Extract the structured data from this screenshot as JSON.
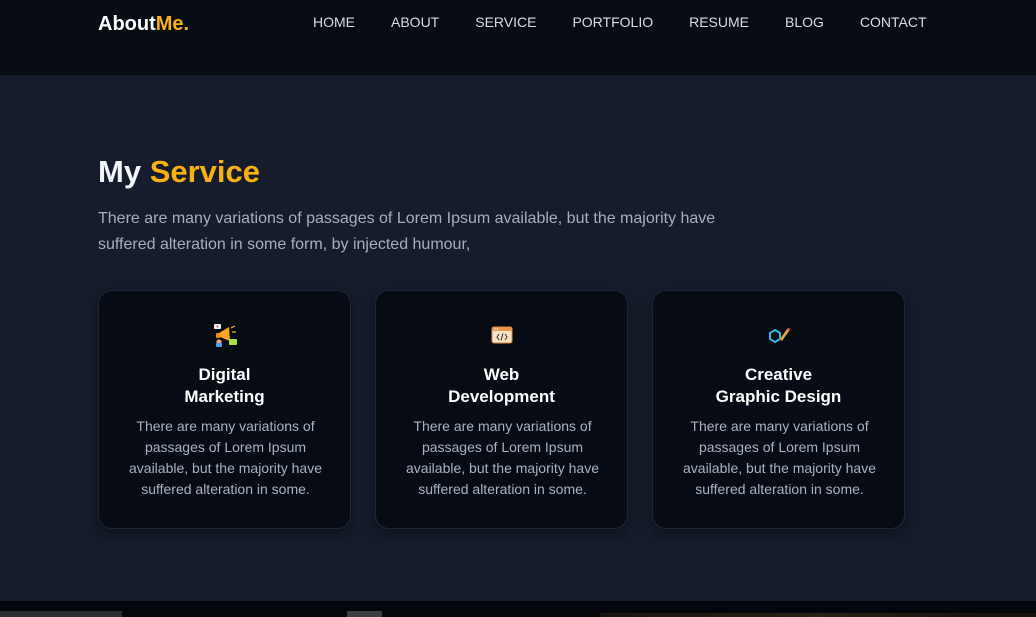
{
  "brand": {
    "name_main": "About",
    "name_accent": "Me."
  },
  "nav": {
    "items": [
      {
        "label": "HOME"
      },
      {
        "label": "ABOUT"
      },
      {
        "label": "SERVICE"
      },
      {
        "label": "PORTFOLIO"
      },
      {
        "label": "RESUME"
      },
      {
        "label": "BLOG"
      },
      {
        "label": "CONTACT"
      }
    ]
  },
  "services": {
    "title_main": "My",
    "title_accent": "Service",
    "description_line1": "There are many variations of passages of Lorem Ipsum available, but the majority have",
    "description_line2": "suffered alteration in some form, by injected humour,",
    "cards": [
      {
        "icon": "megaphone-icon",
        "title_line1": "Digital",
        "title_line2": "Marketing",
        "text": "There are many variations of passages of Lorem Ipsum available, but the majority have suffered alteration in some."
      },
      {
        "icon": "code-window-icon",
        "title_line1": "Web",
        "title_line2": "Development",
        "text": "There are many variations of passages of Lorem Ipsum available, but the majority have suffered alteration in some."
      },
      {
        "icon": "design-pencil-icon",
        "title_line1": "Creative",
        "title_line2": "Graphic Design",
        "text": "There are many variations of passages of Lorem Ipsum available, but the majority have suffered alteration in some."
      }
    ]
  },
  "colors": {
    "accent": "#f8b012",
    "background": "#151c2b",
    "navbar": "#060b14",
    "card": "#060b14"
  }
}
